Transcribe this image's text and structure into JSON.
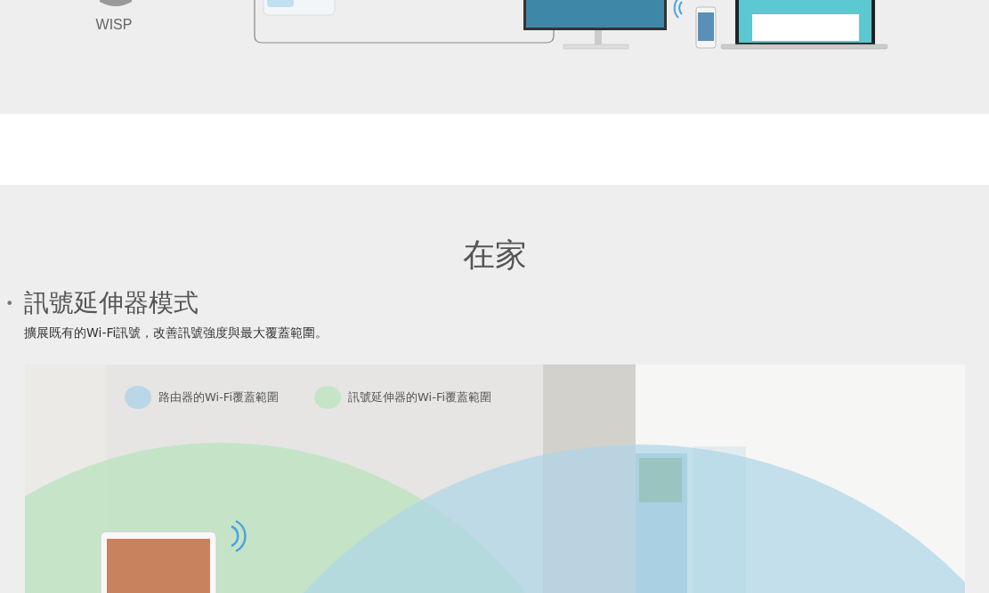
{
  "top_diagram": {
    "label": "WISP"
  },
  "section": {
    "title": "在家"
  },
  "mode": {
    "bullet": "•",
    "title": "訊號延伸器模式",
    "description": "擴展既有的Wi-Fi訊號，改善訊號強度與最大覆蓋範圍。"
  },
  "legend": [
    {
      "label": "路由器的Wi-Fi覆蓋範圍",
      "color": "#b9d7e6"
    },
    {
      "label": "訊號延伸器的Wi-Fi覆蓋範圍",
      "color": "#c5e5c6"
    }
  ]
}
